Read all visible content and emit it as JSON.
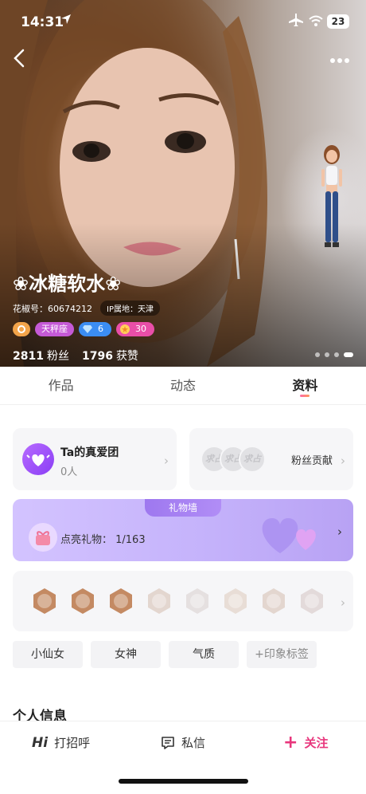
{
  "status_bar": {
    "time": "14:31",
    "battery": "23"
  },
  "profile": {
    "nickname": "❀冰糖软水❀",
    "id_text": "花椒号：60674212",
    "ip_text": "IP属地：天津",
    "badge_sign": "天秤座",
    "badge_gem": "6",
    "badge_level": "30",
    "fans_count": "2811",
    "fans_label": "粉丝",
    "likes_count": "1796",
    "likes_label": "获赞"
  },
  "tabs": [
    {
      "label": "作品"
    },
    {
      "label": "动态"
    },
    {
      "label": "资料"
    }
  ],
  "active_tab": "资料",
  "fan_club": {
    "title": "Ta的真爱团",
    "count": "0人"
  },
  "fan_contribution": {
    "title": "粉丝贡献",
    "placeholders": [
      "求占",
      "求占",
      "求占"
    ]
  },
  "gift_wall": {
    "header": "礼物墙",
    "text": "点亮礼物： 1/163"
  },
  "medals_count": 8,
  "tags": [
    "小仙女",
    "女神",
    "气质",
    "+印象标签"
  ],
  "section_title": "个人信息",
  "bottom_bar": {
    "greet_icon": "Hi",
    "greet_label": "打招呼",
    "message_label": "私信",
    "follow_label": "关注"
  },
  "colors": {
    "accent": "#e8367c",
    "gift_wall": "#c5b3fb",
    "fan_club": "#8a3ef5"
  }
}
